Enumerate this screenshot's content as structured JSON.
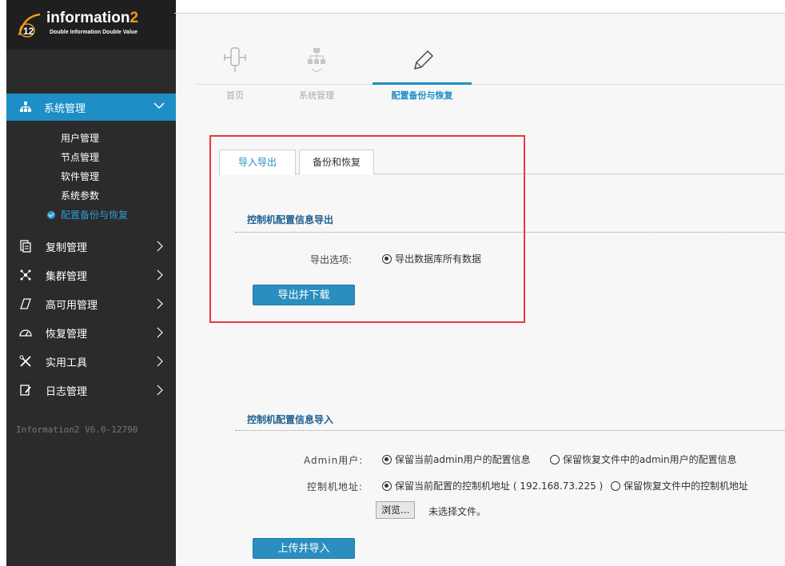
{
  "brand": {
    "name_main": "information",
    "name_suffix": "2",
    "slogan": "Double Information Double Value"
  },
  "sidebar": {
    "active_section": {
      "label": "系统管理",
      "icon": "network-icon"
    },
    "submenu": [
      {
        "label": "用户管理"
      },
      {
        "label": "节点管理"
      },
      {
        "label": "软件管理"
      },
      {
        "label": "系统参数"
      },
      {
        "label": "配置备份与恢复",
        "active": true
      }
    ],
    "items": [
      {
        "label": "复制管理",
        "icon": "copy-icon"
      },
      {
        "label": "集群管理",
        "icon": "cluster-icon"
      },
      {
        "label": "高可用管理",
        "icon": "ha-icon"
      },
      {
        "label": "恢复管理",
        "icon": "restore-icon"
      },
      {
        "label": "实用工具",
        "icon": "tools-icon"
      },
      {
        "label": "日志管理",
        "icon": "log-icon"
      }
    ],
    "version": "Information2 V6.0-12790"
  },
  "breadcrumb_tabs": [
    {
      "label": "首页",
      "icon": "home-icon"
    },
    {
      "label": "系统管理",
      "icon": "system-icon"
    },
    {
      "label": "配置备份与恢复",
      "icon": "pencil-icon",
      "active": true
    }
  ],
  "inner_tabs": [
    {
      "label": "导入导出",
      "active": true
    },
    {
      "label": "备份和恢复"
    }
  ],
  "export_section": {
    "title": "控制机配置信息导出",
    "option_label": "导出选项:",
    "option_value": "导出数据库所有数据",
    "button": "导出并下载"
  },
  "import_section": {
    "title": "控制机配置信息导入",
    "admin_label": "Admin用户:",
    "admin_option1": "保留当前admin用户的配置信息",
    "admin_option2": "保留恢复文件中的admin用户的配置信息",
    "addr_label": "控制机地址:",
    "addr_option1": "保留当前配置的控制机地址 ( 192.168.73.225 )",
    "addr_option2": "保留恢复文件中的控制机地址",
    "browse_button": "浏览...",
    "no_file": "未选择文件。",
    "button": "上传并导入"
  },
  "colors": {
    "accent": "#1e8fc6",
    "sidebar_bg": "#2b2b2b",
    "highlight_box": "#e8383d"
  }
}
